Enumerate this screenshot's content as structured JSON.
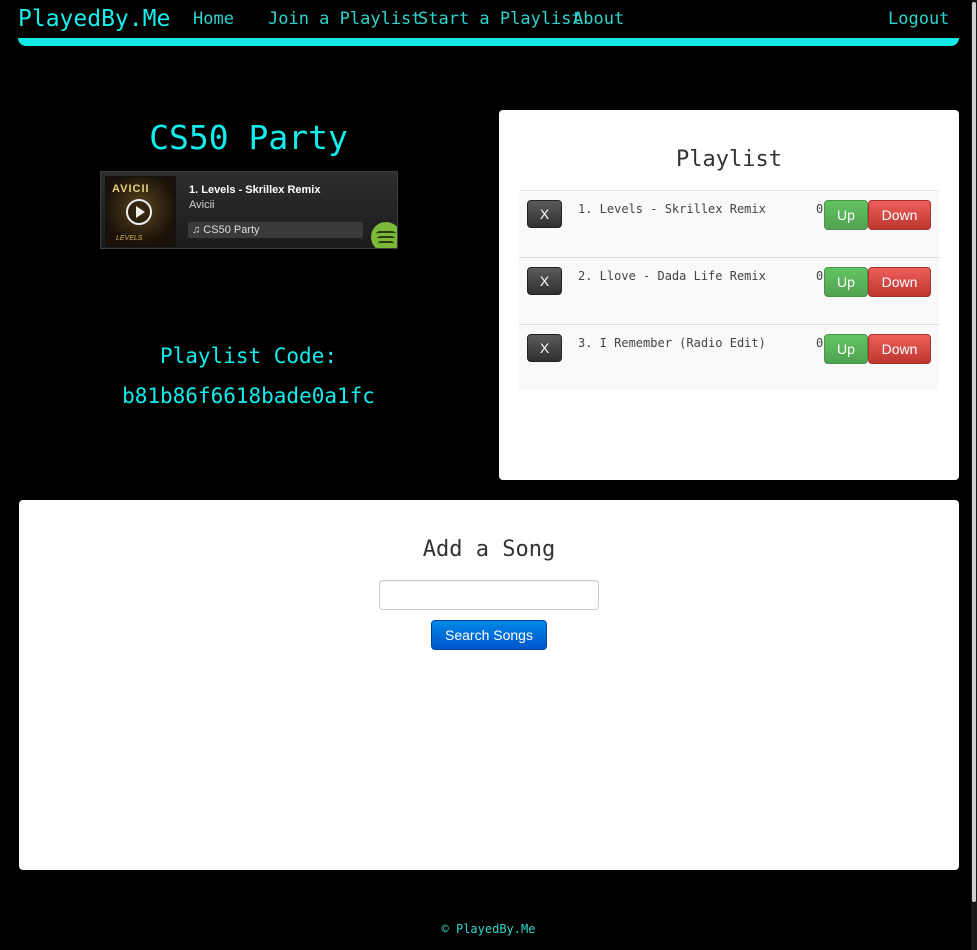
{
  "nav": {
    "brand": "PlayedBy.Me",
    "links": [
      "Home",
      "Join a Playlist",
      "Start a Playlist",
      "About"
    ],
    "logout": "Logout"
  },
  "party": {
    "title": "CS50 Party",
    "code_label": "Playlist Code:",
    "code": "b81b86f6618bade0a1fc"
  },
  "widget": {
    "album_logo": "AVICII",
    "album_caption": "LEVELS",
    "track": "1. Levels - Skrillex Remix",
    "artist": "Avicii",
    "playlist": "♫ CS50 Party",
    "play_icon": "play-icon",
    "brand_icon": "spotify-icon"
  },
  "playlist": {
    "title": "Playlist",
    "remove_label": "X",
    "up_label": "Up",
    "down_label": "Down",
    "songs": [
      {
        "title": "1. Levels - Skrillex Remix",
        "votes": "0"
      },
      {
        "title": "2. Llove - Dada Life Remix",
        "votes": "0"
      },
      {
        "title": "3. I Remember (Radio Edit)",
        "votes": "0"
      }
    ]
  },
  "add_song": {
    "title": "Add a Song",
    "search_value": "",
    "search_button": "Search Songs"
  },
  "footer": "© PlayedBy.Me",
  "colors": {
    "accent": "#12ecec",
    "up": "#5bb75b",
    "down": "#da4f49",
    "primary": "#0074cc"
  }
}
